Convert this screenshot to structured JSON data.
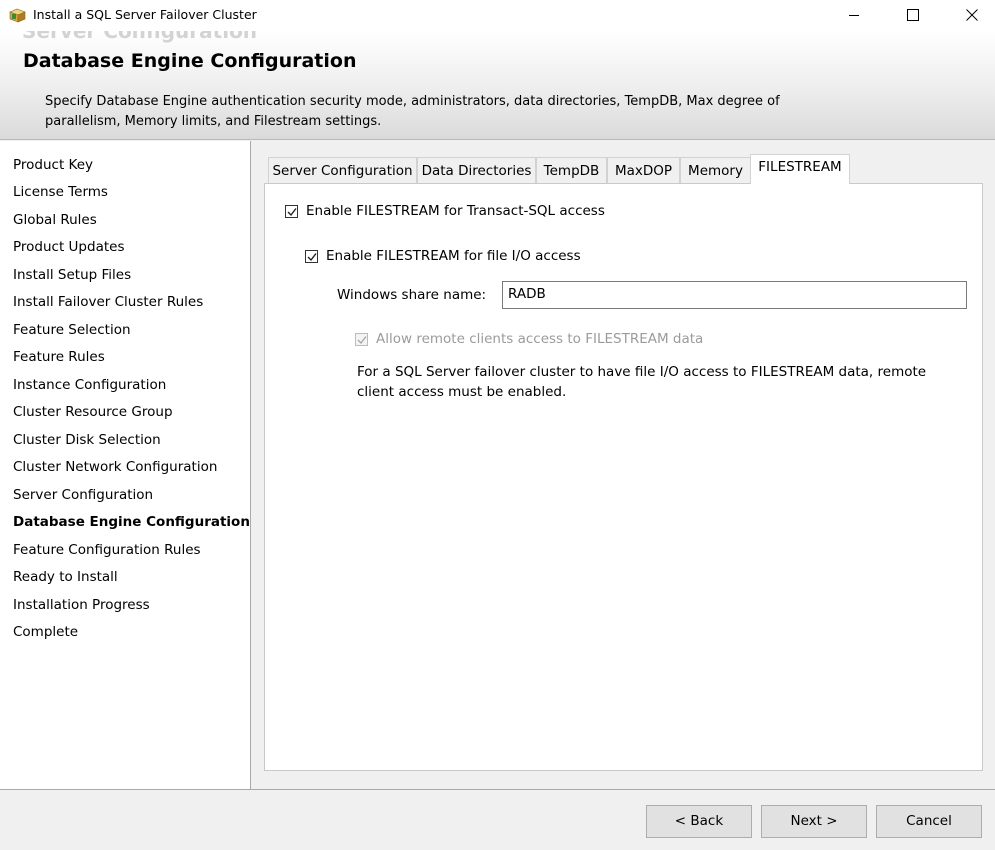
{
  "window": {
    "title": "Install a SQL Server Failover Cluster"
  },
  "header": {
    "ghost_text": "Server Configuration",
    "title": "Database Engine Configuration",
    "description": "Specify Database Engine authentication security mode, administrators, data directories, TempDB, Max degree of parallelism, Memory limits, and Filestream settings."
  },
  "nav": {
    "items": [
      "Product Key",
      "License Terms",
      "Global Rules",
      "Product Updates",
      "Install Setup Files",
      "Install Failover Cluster Rules",
      "Feature Selection",
      "Feature Rules",
      "Instance Configuration",
      "Cluster Resource Group",
      "Cluster Disk Selection",
      "Cluster Network Configuration",
      "Server Configuration",
      "Database Engine Configuration",
      "Feature Configuration Rules",
      "Ready to Install",
      "Installation Progress",
      "Complete"
    ],
    "active": "Database Engine Configuration"
  },
  "tabs": [
    "Server Configuration",
    "Data Directories",
    "TempDB",
    "MaxDOP",
    "Memory",
    "FILESTREAM"
  ],
  "active_tab": "FILESTREAM",
  "filestream": {
    "tsql_label": "Enable FILESTREAM for Transact-SQL access",
    "tsql_checked": true,
    "fileio_label": "Enable FILESTREAM for file I/O access",
    "fileio_checked": true,
    "share_label": "Windows share name:",
    "share_value": "RADB",
    "remote_label": "Allow remote clients access to FILESTREAM data",
    "remote_checked": true,
    "remote_enabled": false,
    "info_text": "For a SQL Server failover cluster to have file I/O access to FILESTREAM data, remote client access must be enabled."
  },
  "buttons": {
    "back": "< Back",
    "next": "Next >",
    "cancel": "Cancel"
  },
  "icons": {
    "app": "setup-box-icon",
    "minimize": "minimize-icon",
    "maximize": "maximize-icon",
    "close": "close-icon",
    "check": "checkmark-icon"
  }
}
